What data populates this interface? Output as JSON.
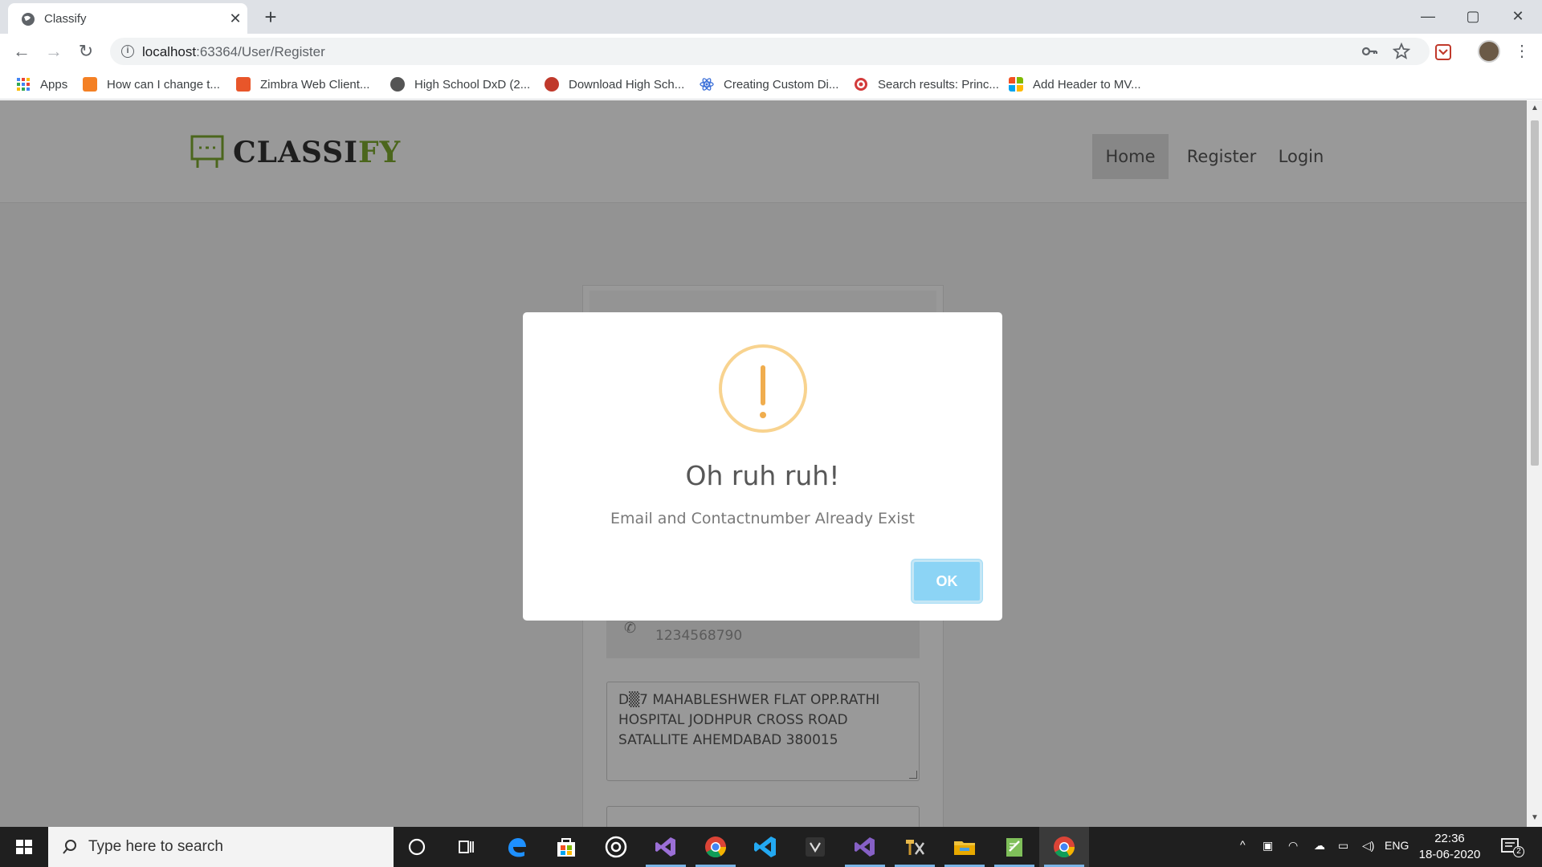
{
  "browser": {
    "tab_title": "Classify",
    "tab_close": "✕",
    "new_tab": "+",
    "url_host": "localhost",
    "url_path": ":63364/User/Register",
    "window_controls": {
      "minimize": "—",
      "maximize": "▢",
      "close": "✕"
    },
    "nav": {
      "back": "←",
      "forward": "→",
      "reload": "↻"
    },
    "omnibox_icons": [
      "key-icon",
      "star-icon"
    ],
    "info_glyph": "i"
  },
  "bookmarks": [
    {
      "label": "Apps",
      "icon": "apps-grid-icon",
      "color": "#4285f4"
    },
    {
      "label": "How can I change t...",
      "icon": "stackoverflow-icon",
      "color": "#f48024"
    },
    {
      "label": "Zimbra Web Client...",
      "icon": "zimbra-icon",
      "color": "#e8562a"
    },
    {
      "label": "High School DxD (2...",
      "icon": "globe-icon",
      "color": "#555555"
    },
    {
      "label": "Download High Sch...",
      "icon": "red-circle-icon",
      "color": "#c0392b"
    },
    {
      "label": "Creating Custom Di...",
      "icon": "react-atom-icon",
      "color": "#3b6fd8"
    },
    {
      "label": "Search results: Princ...",
      "icon": "target-icon",
      "color": "#d33b3b"
    },
    {
      "label": "Add Header to MV...",
      "icon": "microsoft-icon",
      "color": "#f25022"
    }
  ],
  "site": {
    "logo_main": "CLASSI",
    "logo_accent": "FY",
    "nav": [
      {
        "label": "Home",
        "active": true
      },
      {
        "label": "Register",
        "active": false
      },
      {
        "label": "Login",
        "active": false
      }
    ],
    "colors": {
      "accent": "#7dab2f"
    }
  },
  "form": {
    "phone_value": "1234568790",
    "address_value": "D▒7 MAHABLESHWER FLAT OPP.RATHI HOSPITAL JODHPUR CROSS ROAD SATALLITE AHEMDABAD 380015"
  },
  "modal": {
    "icon": "warning-icon",
    "title": "Oh ruh ruh!",
    "message": "Email and Contactnumber Already Exist",
    "ok_label": "OK",
    "colors": {
      "warning": "#f0ad4e",
      "ok_button": "#8cd4f5"
    }
  },
  "taskbar": {
    "search_placeholder": "Type here to search",
    "apps": [
      "cortana-icon",
      "task-view-icon",
      "edge-icon",
      "store-icon",
      "groove-icon",
      "visual-studio-icon",
      "chrome-icon",
      "vscode-icon",
      "unity-icon",
      "visual-studio-icon",
      "tools-icon",
      "file-explorer-icon",
      "notepad-icon",
      "chrome-icon"
    ],
    "language": "ENG",
    "time": "22:36",
    "date": "18-06-2020",
    "notifications": "2"
  }
}
